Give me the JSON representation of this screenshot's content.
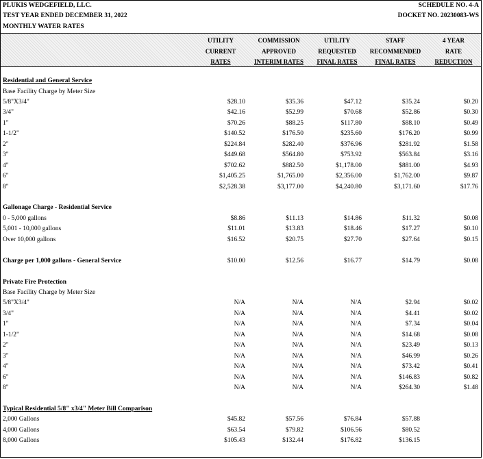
{
  "header": {
    "company": "PLUKIS WEDGEFIELD, LLC.",
    "schedule": "SCHEDULE NO. 4-A",
    "period": "TEST YEAR ENDED DECEMBER 31, 2022",
    "docket": "DOCKET NO. 20230083-WS",
    "subject": "MONTHLY WATER RATES"
  },
  "columns": [
    {
      "l1": "UTILITY",
      "l2": "CURRENT",
      "l3": "RATES"
    },
    {
      "l1": "COMMISSION",
      "l2": "APPROVED",
      "l3": "INTERIM RATES"
    },
    {
      "l1": "UTILITY",
      "l2": "REQUESTED",
      "l3": "FINAL RATES"
    },
    {
      "l1": "STAFF",
      "l2": "RECOMMENDED",
      "l3": "FINAL RATES"
    },
    {
      "l1": "4 YEAR",
      "l2": "RATE",
      "l3": "REDUCTION"
    }
  ],
  "rows": [
    {
      "type": "section",
      "label": "Residential and General Service"
    },
    {
      "type": "label",
      "label": "Base Facility Charge by Meter Size"
    },
    {
      "type": "data",
      "label": "5/8\"X3/4\"",
      "values": [
        "$28.10",
        "$35.36",
        "$47.12",
        "$35.24",
        "$0.20"
      ]
    },
    {
      "type": "data",
      "label": "3/4\"",
      "values": [
        "$42.16",
        "$52.99",
        "$70.68",
        "$52.86",
        "$0.30"
      ]
    },
    {
      "type": "data",
      "label": "1\"",
      "values": [
        "$70.26",
        "$88.25",
        "$117.80",
        "$88.10",
        "$0.49"
      ]
    },
    {
      "type": "data",
      "label": "1-1/2\"",
      "values": [
        "$140.52",
        "$176.50",
        "$235.60",
        "$176.20",
        "$0.99"
      ]
    },
    {
      "type": "data",
      "label": "2\"",
      "values": [
        "$224.84",
        "$282.40",
        "$376.96",
        "$281.92",
        "$1.58"
      ]
    },
    {
      "type": "data",
      "label": "3\"",
      "values": [
        "$449.68",
        "$564.80",
        "$753.92",
        "$563.84",
        "$3.16"
      ]
    },
    {
      "type": "data",
      "label": "4\"",
      "values": [
        "$702.62",
        "$882.50",
        "$1,178.00",
        "$881.00",
        "$4.93"
      ]
    },
    {
      "type": "data",
      "label": "6\"",
      "values": [
        "$1,405.25",
        "$1,765.00",
        "$2,356.00",
        "$1,762.00",
        "$9.87"
      ]
    },
    {
      "type": "data",
      "label": "8\"",
      "values": [
        "$2,528.38",
        "$3,177.00",
        "$4,240.80",
        "$3,171.60",
        "$17.76"
      ]
    },
    {
      "type": "blank"
    },
    {
      "type": "subsection",
      "label": "Gallonage Charge - Residential Service"
    },
    {
      "type": "data",
      "label": "0 - 5,000 gallons",
      "values": [
        "$8.86",
        "$11.13",
        "$14.86",
        "$11.32",
        "$0.08"
      ]
    },
    {
      "type": "data",
      "label": "5,001 - 10,000 gallons",
      "values": [
        "$11.01",
        "$13.83",
        "$18.46",
        "$17.27",
        "$0.10"
      ]
    },
    {
      "type": "data",
      "label": "Over 10,000 gallons",
      "values": [
        "$16.52",
        "$20.75",
        "$27.70",
        "$27.64",
        "$0.15"
      ]
    },
    {
      "type": "blank"
    },
    {
      "type": "subsection",
      "label": "Charge per 1,000 gallons - General Service",
      "values": [
        "$10.00",
        "$12.56",
        "$16.77",
        "$14.79",
        "$0.08"
      ]
    },
    {
      "type": "blank"
    },
    {
      "type": "subsection",
      "label": "Private Fire Protection"
    },
    {
      "type": "label",
      "label": "Base Facility Charge by Meter Size"
    },
    {
      "type": "data",
      "label": "5/8\"X3/4\"",
      "values": [
        "N/A",
        "N/A",
        "N/A",
        "$2.94",
        "$0.02"
      ]
    },
    {
      "type": "data",
      "label": "3/4\"",
      "values": [
        "N/A",
        "N/A",
        "N/A",
        "$4.41",
        "$0.02"
      ]
    },
    {
      "type": "data",
      "label": "1\"",
      "values": [
        "N/A",
        "N/A",
        "N/A",
        "$7.34",
        "$0.04"
      ]
    },
    {
      "type": "data",
      "label": "1-1/2\"",
      "values": [
        "N/A",
        "N/A",
        "N/A",
        "$14.68",
        "$0.08"
      ]
    },
    {
      "type": "data",
      "label": "2\"",
      "values": [
        "N/A",
        "N/A",
        "N/A",
        "$23.49",
        "$0.13"
      ]
    },
    {
      "type": "data",
      "label": "3\"",
      "values": [
        "N/A",
        "N/A",
        "N/A",
        "$46.99",
        "$0.26"
      ]
    },
    {
      "type": "data",
      "label": "4\"",
      "values": [
        "N/A",
        "N/A",
        "N/A",
        "$73.42",
        "$0.41"
      ]
    },
    {
      "type": "data",
      "label": "6\"",
      "values": [
        "N/A",
        "N/A",
        "N/A",
        "$146.83",
        "$0.82"
      ]
    },
    {
      "type": "data",
      "label": "8\"",
      "values": [
        "N/A",
        "N/A",
        "N/A",
        "$264.30",
        "$1.48"
      ]
    },
    {
      "type": "blank"
    },
    {
      "type": "section",
      "label": "Typical Residential 5/8\" x3/4\" Meter Bill Comparison"
    },
    {
      "type": "data",
      "label": "2,000 Gallons",
      "values": [
        "$45.82",
        "$57.56",
        "$76.84",
        "$57.88",
        ""
      ]
    },
    {
      "type": "data",
      "label": "4,000 Gallons",
      "values": [
        "$63.54",
        "$79.82",
        "$106.56",
        "$80.52",
        ""
      ]
    },
    {
      "type": "data",
      "label": "8,000 Gallons",
      "values": [
        "$105.43",
        "$132.44",
        "$176.82",
        "$136.15",
        ""
      ]
    }
  ]
}
